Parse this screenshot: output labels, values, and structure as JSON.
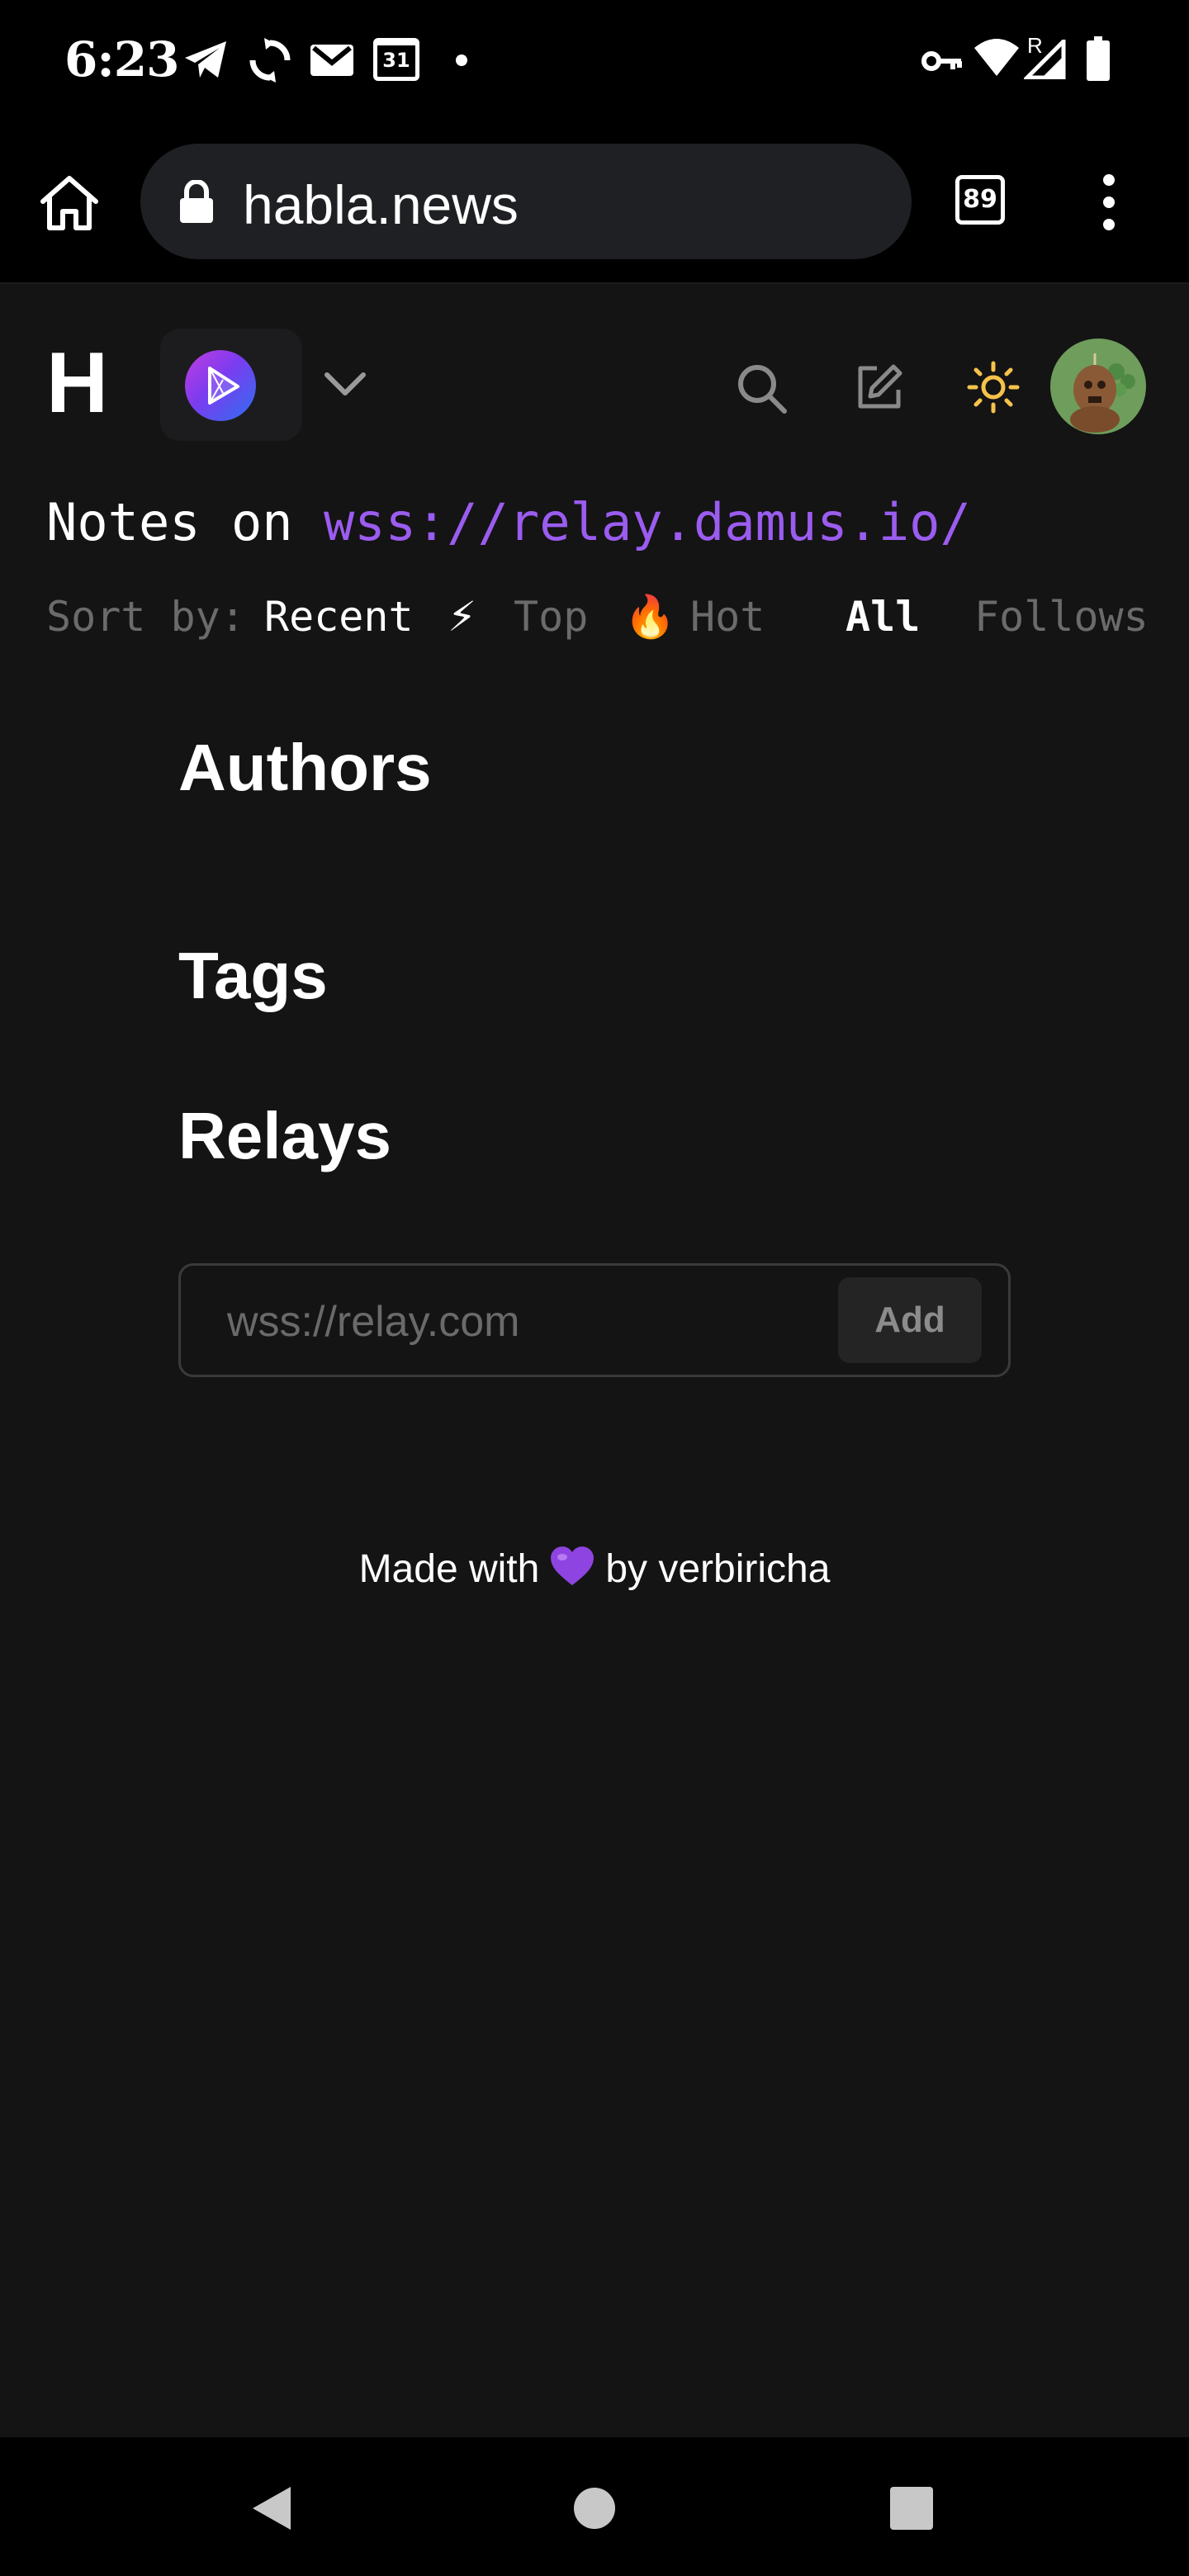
{
  "status_bar": {
    "time": "6:23",
    "calendar_day": "31",
    "network_label": "R",
    "icons": [
      "telegram-icon",
      "sync-icon",
      "gmail-icon",
      "calendar-icon",
      "dot-icon",
      "vpn-key-icon",
      "wifi-icon",
      "signal-icon",
      "battery-icon"
    ]
  },
  "browser": {
    "url": "habla.news",
    "tab_count": "89"
  },
  "header": {
    "logo_text": "H",
    "icons": [
      "relay-logo-icon",
      "chevron-down-icon",
      "search-icon",
      "edit-icon",
      "sun-icon",
      "avatar"
    ]
  },
  "notes": {
    "prefix": "Notes on ",
    "relay_url": "wss://relay.damus.io/"
  },
  "sort": {
    "label": "Sort by:",
    "recent": "Recent",
    "top_emoji": "⚡",
    "top": "Top",
    "hot_emoji": "🔥",
    "hot": "Hot",
    "all": "All",
    "follows": "Follows"
  },
  "sections": {
    "authors": "Authors",
    "tags": "Tags",
    "relays": "Relays"
  },
  "relay_form": {
    "placeholder": "wss://relay.com",
    "add_label": "Add"
  },
  "footer": {
    "made_with": "Made with",
    "by": "by verbiricha"
  },
  "colors": {
    "accent": "#9b5cf0",
    "background": "#141414",
    "muted": "#6b6b6b"
  }
}
